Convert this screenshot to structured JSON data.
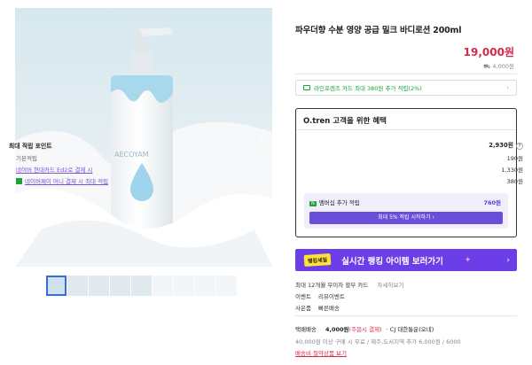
{
  "product": {
    "title": "파우더향 수분 영양 공급 밀크 바디로션 200ml",
    "price": "19,000원",
    "original_price": "4,000원",
    "brand_on_bottle": "AECOYAM"
  },
  "card_promo": {
    "text": "라인프렌즈 카드 최대 380원 추가 적립(2%)",
    "chevron": "›"
  },
  "benefit": {
    "title": "O.tren 고객을 위한 혜택",
    "max_points_label": "최대 적립 포인트",
    "max_points_value": "2,930원",
    "help": "?",
    "rows": [
      {
        "label": "기본적립",
        "value": "190원"
      },
      {
        "label": "네이버 현대카드 Ed2로 결제 시",
        "value": "1,330원"
      },
      {
        "label": "네이버페이 머니 결제 시 최대 적립",
        "value": "380원"
      }
    ],
    "membership_label": "멤버십 추가 적립",
    "membership_badge": "N",
    "membership_value": "760원",
    "membership_button": "최대 5% 적립 시작하기 ›"
  },
  "ranking": {
    "badge": "랭킹세일",
    "text": "실시간 랭킹 아이템 보러가기",
    "chevron": "›"
  },
  "meta": {
    "installment": "최대 12개월 무이자 할부 카드",
    "installment_link": "자세히보기",
    "events": [
      "이벤트",
      "리뷰이벤트"
    ],
    "gifts": [
      "사은품",
      "빠른배송"
    ]
  },
  "shipping": {
    "label": "택배배송",
    "fee": "4,000원",
    "fee_note": "(주문시 결제)",
    "carrier": "· CJ 대한통운(오네)",
    "condition": "40,000원 이상 구매 시 무료 / 제주,도서지역 추가 6,000원 / 6000",
    "link": "배송비 절약상품 보기"
  },
  "gallery": {
    "prev": "‹",
    "next": "›",
    "thumbnail_count": 9
  }
}
